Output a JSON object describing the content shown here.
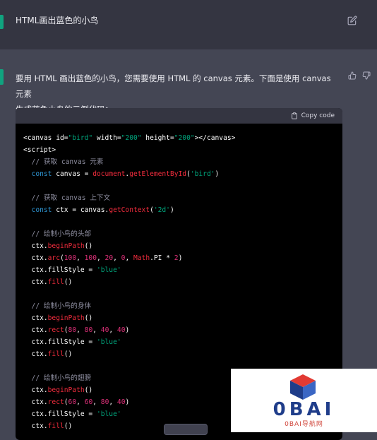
{
  "user_message": {
    "text": "HTML画出蓝色的小鸟"
  },
  "assistant": {
    "intro_line1": "要用 HTML 画出蓝色的小鸟，您需要使用 HTML 的 canvas 元素。下面是使用 canvas 元素",
    "intro_line2": "生成蓝色小鸟的示例代码："
  },
  "code_block": {
    "copy_label": "Copy code",
    "lines": [
      [
        {
          "t": "tag",
          "v": "<canvas "
        },
        {
          "t": "attr",
          "v": "id="
        },
        {
          "t": "str",
          "v": "\"bird\""
        },
        {
          "t": "attr",
          "v": " width="
        },
        {
          "t": "str",
          "v": "\"200\""
        },
        {
          "t": "attr",
          "v": " height="
        },
        {
          "t": "str",
          "v": "\"200\""
        },
        {
          "t": "tag",
          "v": "></canvas>"
        }
      ],
      [
        {
          "t": "tag",
          "v": "<script>"
        }
      ],
      [
        {
          "t": "cmt",
          "v": "  // 获取 canvas 元素"
        }
      ],
      [
        {
          "t": "kw",
          "v": "  const "
        },
        {
          "t": "plain",
          "v": "canvas = "
        },
        {
          "t": "fn",
          "v": "document"
        },
        {
          "t": "plain",
          "v": "."
        },
        {
          "t": "fn",
          "v": "getElementById"
        },
        {
          "t": "plain",
          "v": "("
        },
        {
          "t": "str",
          "v": "'bird'"
        },
        {
          "t": "plain",
          "v": ")"
        }
      ],
      [
        {
          "t": "plain",
          "v": ""
        }
      ],
      [
        {
          "t": "cmt",
          "v": "  // 获取 canvas 上下文"
        }
      ],
      [
        {
          "t": "kw",
          "v": "  const "
        },
        {
          "t": "plain",
          "v": "ctx = canvas."
        },
        {
          "t": "fn",
          "v": "getContext"
        },
        {
          "t": "plain",
          "v": "("
        },
        {
          "t": "str",
          "v": "'2d'"
        },
        {
          "t": "plain",
          "v": ")"
        }
      ],
      [
        {
          "t": "plain",
          "v": ""
        }
      ],
      [
        {
          "t": "cmt",
          "v": "  // 绘制小鸟的头部"
        }
      ],
      [
        {
          "t": "plain",
          "v": "  ctx."
        },
        {
          "t": "fn",
          "v": "beginPath"
        },
        {
          "t": "plain",
          "v": "()"
        }
      ],
      [
        {
          "t": "plain",
          "v": "  ctx."
        },
        {
          "t": "fn",
          "v": "arc"
        },
        {
          "t": "plain",
          "v": "("
        },
        {
          "t": "num",
          "v": "100"
        },
        {
          "t": "plain",
          "v": ", "
        },
        {
          "t": "num",
          "v": "100"
        },
        {
          "t": "plain",
          "v": ", "
        },
        {
          "t": "num",
          "v": "20"
        },
        {
          "t": "plain",
          "v": ", "
        },
        {
          "t": "num",
          "v": "0"
        },
        {
          "t": "plain",
          "v": ", "
        },
        {
          "t": "fn",
          "v": "Math"
        },
        {
          "t": "plain",
          "v": ".PI * "
        },
        {
          "t": "num",
          "v": "2"
        },
        {
          "t": "plain",
          "v": ")"
        }
      ],
      [
        {
          "t": "plain",
          "v": "  ctx.fillStyle = "
        },
        {
          "t": "str",
          "v": "'blue'"
        }
      ],
      [
        {
          "t": "plain",
          "v": "  ctx."
        },
        {
          "t": "fn",
          "v": "fill"
        },
        {
          "t": "plain",
          "v": "()"
        }
      ],
      [
        {
          "t": "plain",
          "v": ""
        }
      ],
      [
        {
          "t": "cmt",
          "v": "  // 绘制小鸟的身体"
        }
      ],
      [
        {
          "t": "plain",
          "v": "  ctx."
        },
        {
          "t": "fn",
          "v": "beginPath"
        },
        {
          "t": "plain",
          "v": "()"
        }
      ],
      [
        {
          "t": "plain",
          "v": "  ctx."
        },
        {
          "t": "fn",
          "v": "rect"
        },
        {
          "t": "plain",
          "v": "("
        },
        {
          "t": "num",
          "v": "80"
        },
        {
          "t": "plain",
          "v": ", "
        },
        {
          "t": "num",
          "v": "80"
        },
        {
          "t": "plain",
          "v": ", "
        },
        {
          "t": "num",
          "v": "40"
        },
        {
          "t": "plain",
          "v": ", "
        },
        {
          "t": "num",
          "v": "40"
        },
        {
          "t": "plain",
          "v": ")"
        }
      ],
      [
        {
          "t": "plain",
          "v": "  ctx.fillStyle = "
        },
        {
          "t": "str",
          "v": "'blue'"
        }
      ],
      [
        {
          "t": "plain",
          "v": "  ctx."
        },
        {
          "t": "fn",
          "v": "fill"
        },
        {
          "t": "plain",
          "v": "()"
        }
      ],
      [
        {
          "t": "plain",
          "v": ""
        }
      ],
      [
        {
          "t": "cmt",
          "v": "  // 绘制小鸟的翅膀"
        }
      ],
      [
        {
          "t": "plain",
          "v": "  ctx."
        },
        {
          "t": "fn",
          "v": "beginPath"
        },
        {
          "t": "plain",
          "v": "()"
        }
      ],
      [
        {
          "t": "plain",
          "v": "  ctx."
        },
        {
          "t": "fn",
          "v": "rect"
        },
        {
          "t": "plain",
          "v": "("
        },
        {
          "t": "num",
          "v": "60"
        },
        {
          "t": "plain",
          "v": ", "
        },
        {
          "t": "num",
          "v": "60"
        },
        {
          "t": "plain",
          "v": ", "
        },
        {
          "t": "num",
          "v": "80"
        },
        {
          "t": "plain",
          "v": ", "
        },
        {
          "t": "num",
          "v": "40"
        },
        {
          "t": "plain",
          "v": ")"
        }
      ],
      [
        {
          "t": "plain",
          "v": "  ctx.fillStyle = "
        },
        {
          "t": "str",
          "v": "'blue'"
        }
      ],
      [
        {
          "t": "plain",
          "v": "  ctx."
        },
        {
          "t": "fn",
          "v": "fill"
        },
        {
          "t": "plain",
          "v": "()"
        }
      ]
    ]
  },
  "watermark": {
    "title": "0BAI",
    "subtitle": "0BAI导航网"
  },
  "colors": {
    "page_bg": "#444654",
    "user_bg": "#343541",
    "accent": "#10a37f",
    "code_bg": "#000000",
    "code_header_bg": "#343541"
  },
  "icons": [
    "edit-icon",
    "thumbs-up-icon",
    "thumbs-down-icon",
    "clipboard-icon",
    "cube-logo-icon"
  ]
}
